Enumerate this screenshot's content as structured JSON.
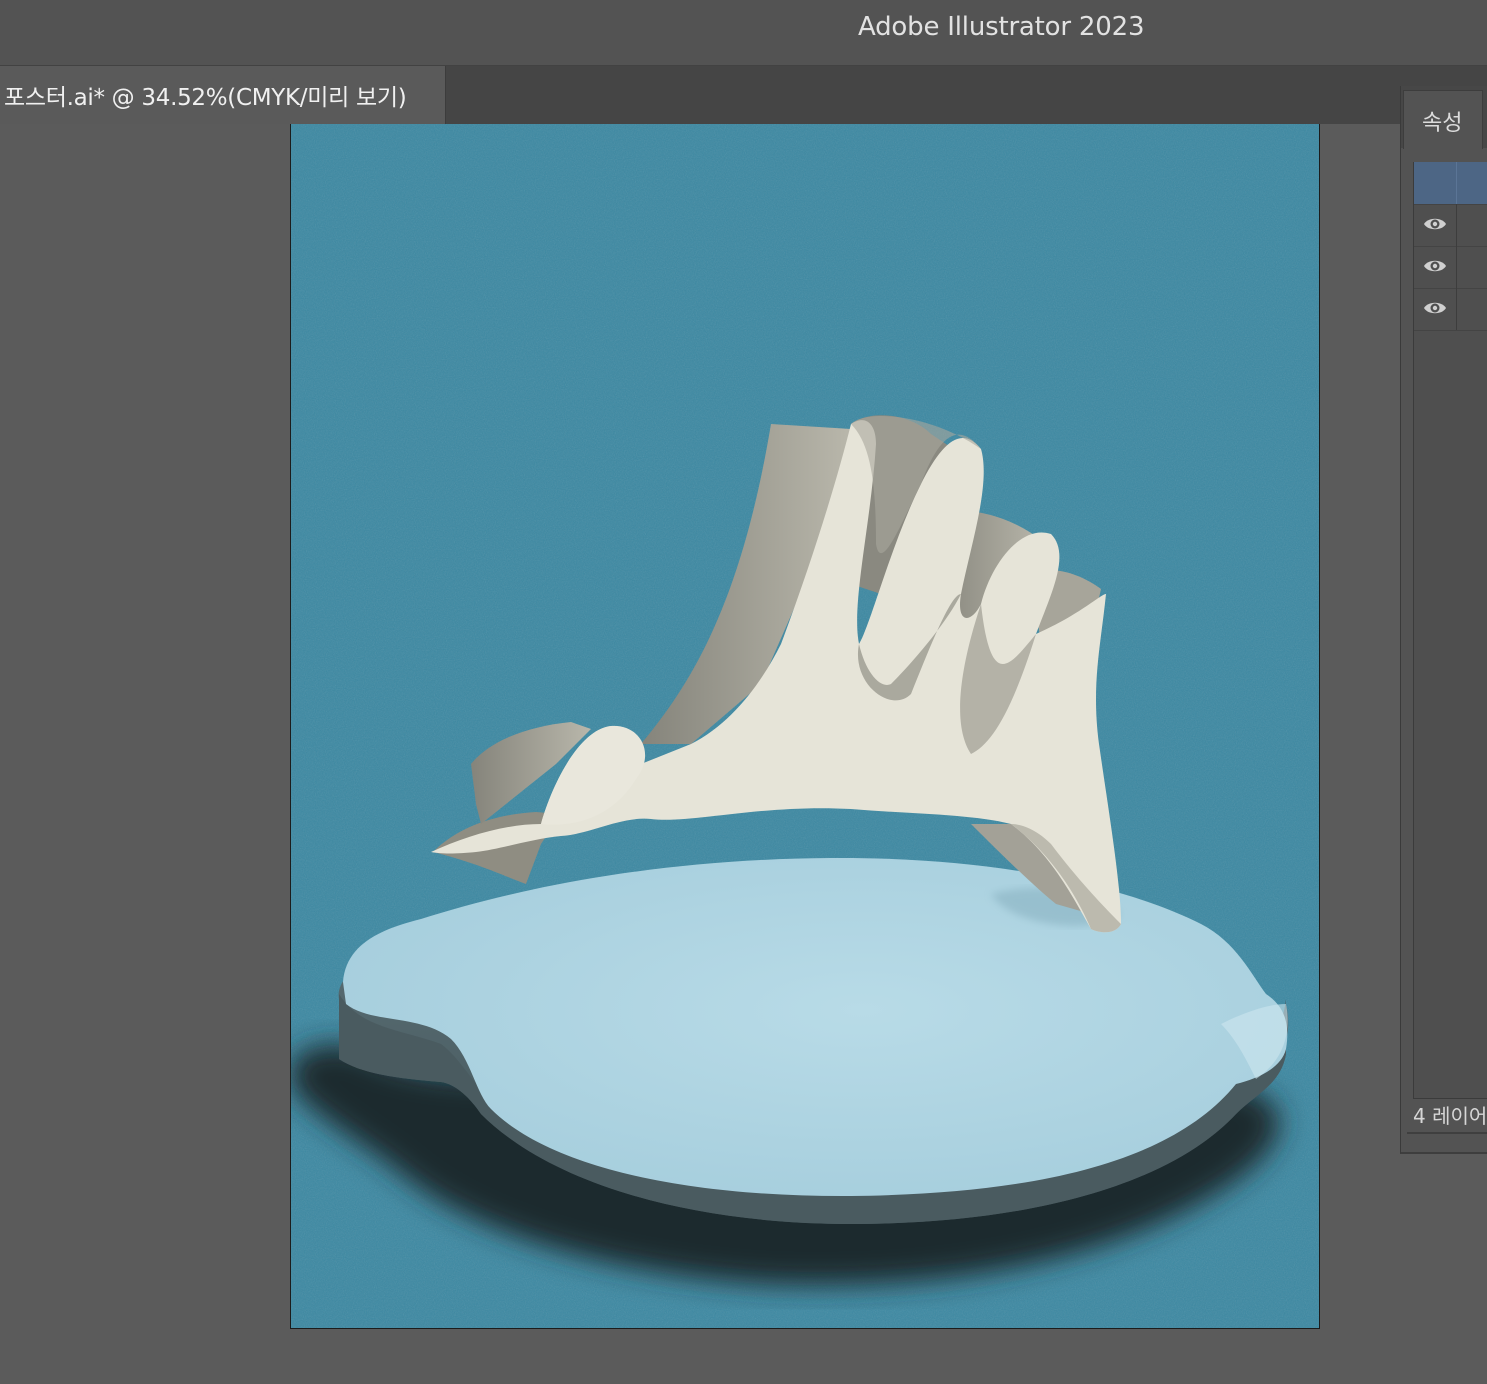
{
  "app": {
    "title": "Adobe Illustrator 2023"
  },
  "document_tab": {
    "label": "포스터.ai* @ 34.52%(CMYK/미리 보기)"
  },
  "properties_panel": {
    "tab_label": "속성",
    "layers": [
      {
        "selected": true,
        "visible": true,
        "visibility_icon": "none"
      },
      {
        "selected": false,
        "visible": true,
        "visibility_icon": "eye-icon"
      },
      {
        "selected": false,
        "visible": true,
        "visibility_icon": "eye-icon"
      },
      {
        "selected": false,
        "visible": true,
        "visibility_icon": "eye-icon"
      }
    ],
    "layer_count_label": "4 레이어"
  },
  "artwork": {
    "background_color": "#3b88a2",
    "sculpture_color": "#e6e4d8",
    "pedestal_color": "#b3d6e3",
    "pedestal_side_color": "#4a5b60",
    "shadow_color": "#1b2b2f"
  }
}
